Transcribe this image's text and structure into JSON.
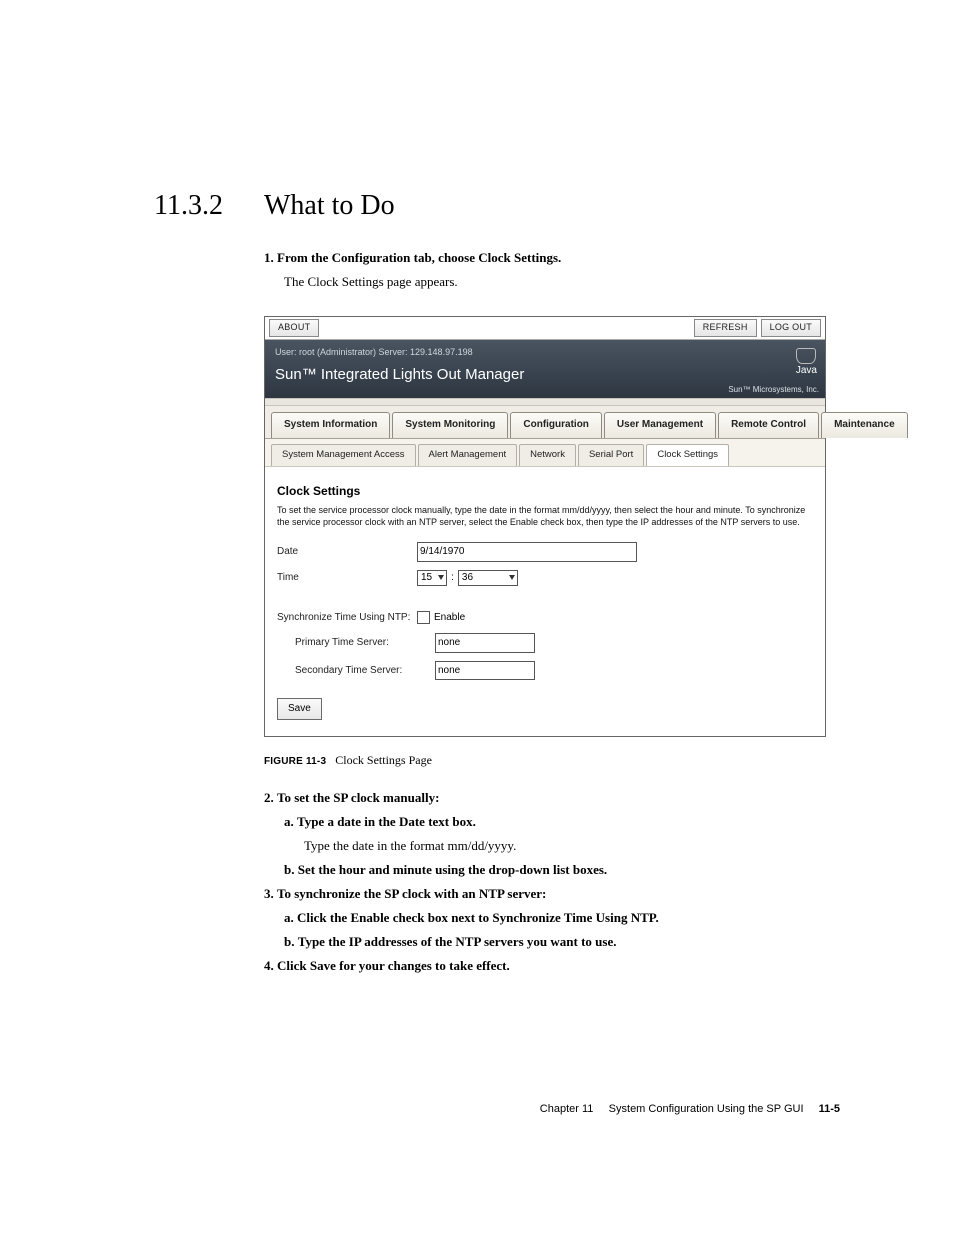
{
  "section": {
    "number": "11.3.2",
    "title": "What to Do"
  },
  "steps": {
    "s1_num": "1.",
    "s1": "From the Configuration tab, choose Clock Settings.",
    "s1_body": "The Clock Settings page appears.",
    "s2_num": "2.",
    "s2": "To set the SP clock manually:",
    "s2a_num": "a.",
    "s2a": "Type a date in the Date text box.",
    "s2a_body": "Type the date in the format mm/dd/yyyy.",
    "s2b_num": "b.",
    "s2b": "Set the hour and minute using the drop-down list boxes.",
    "s3_num": "3.",
    "s3": "To synchronize the SP clock with an NTP server:",
    "s3a_num": "a.",
    "s3a": "Click the Enable check box next to Synchronize Time Using NTP.",
    "s3b_num": "b.",
    "s3b": "Type the IP addresses of the NTP servers you want to use.",
    "s4_num": "4.",
    "s4": "Click Save for your changes to take effect."
  },
  "figure": {
    "label": "FIGURE 11-3",
    "caption": "Clock Settings Page"
  },
  "footer": {
    "chapter": "Chapter 11",
    "title": "System Configuration Using the SP GUI",
    "page": "11-5"
  },
  "shot": {
    "about": "ABOUT",
    "refresh": "REFRESH",
    "logout": "LOG OUT",
    "userline": "User: root (Administrator)   Server: 129.148.97.198",
    "product": "Sun™ Integrated Lights Out Manager",
    "java": "Java",
    "sunline": "Sun™ Microsystems, Inc.",
    "tabs": [
      "System Information",
      "System Monitoring",
      "Configuration",
      "User Management",
      "Remote Control",
      "Maintenance"
    ],
    "subtabs": [
      "System Management Access",
      "Alert Management",
      "Network",
      "Serial Port",
      "Clock Settings"
    ],
    "panel_title": "Clock Settings",
    "panel_desc": "To set the service processor clock manually, type the date in the format mm/dd/yyyy, then select the hour and minute. To synchronize the service processor clock with an NTP server, select the Enable check box, then type the IP addresses of the NTP servers to use.",
    "lbl_date": "Date",
    "val_date": "9/14/1970",
    "lbl_time": "Time",
    "val_hour": "15",
    "time_sep": ":",
    "val_min": "36",
    "lbl_ntp": "Synchronize Time Using NTP:",
    "lbl_enable": "Enable",
    "lbl_primary": "Primary Time Server:",
    "val_primary": "none",
    "lbl_secondary": "Secondary Time Server:",
    "val_secondary": "none",
    "save": "Save"
  }
}
